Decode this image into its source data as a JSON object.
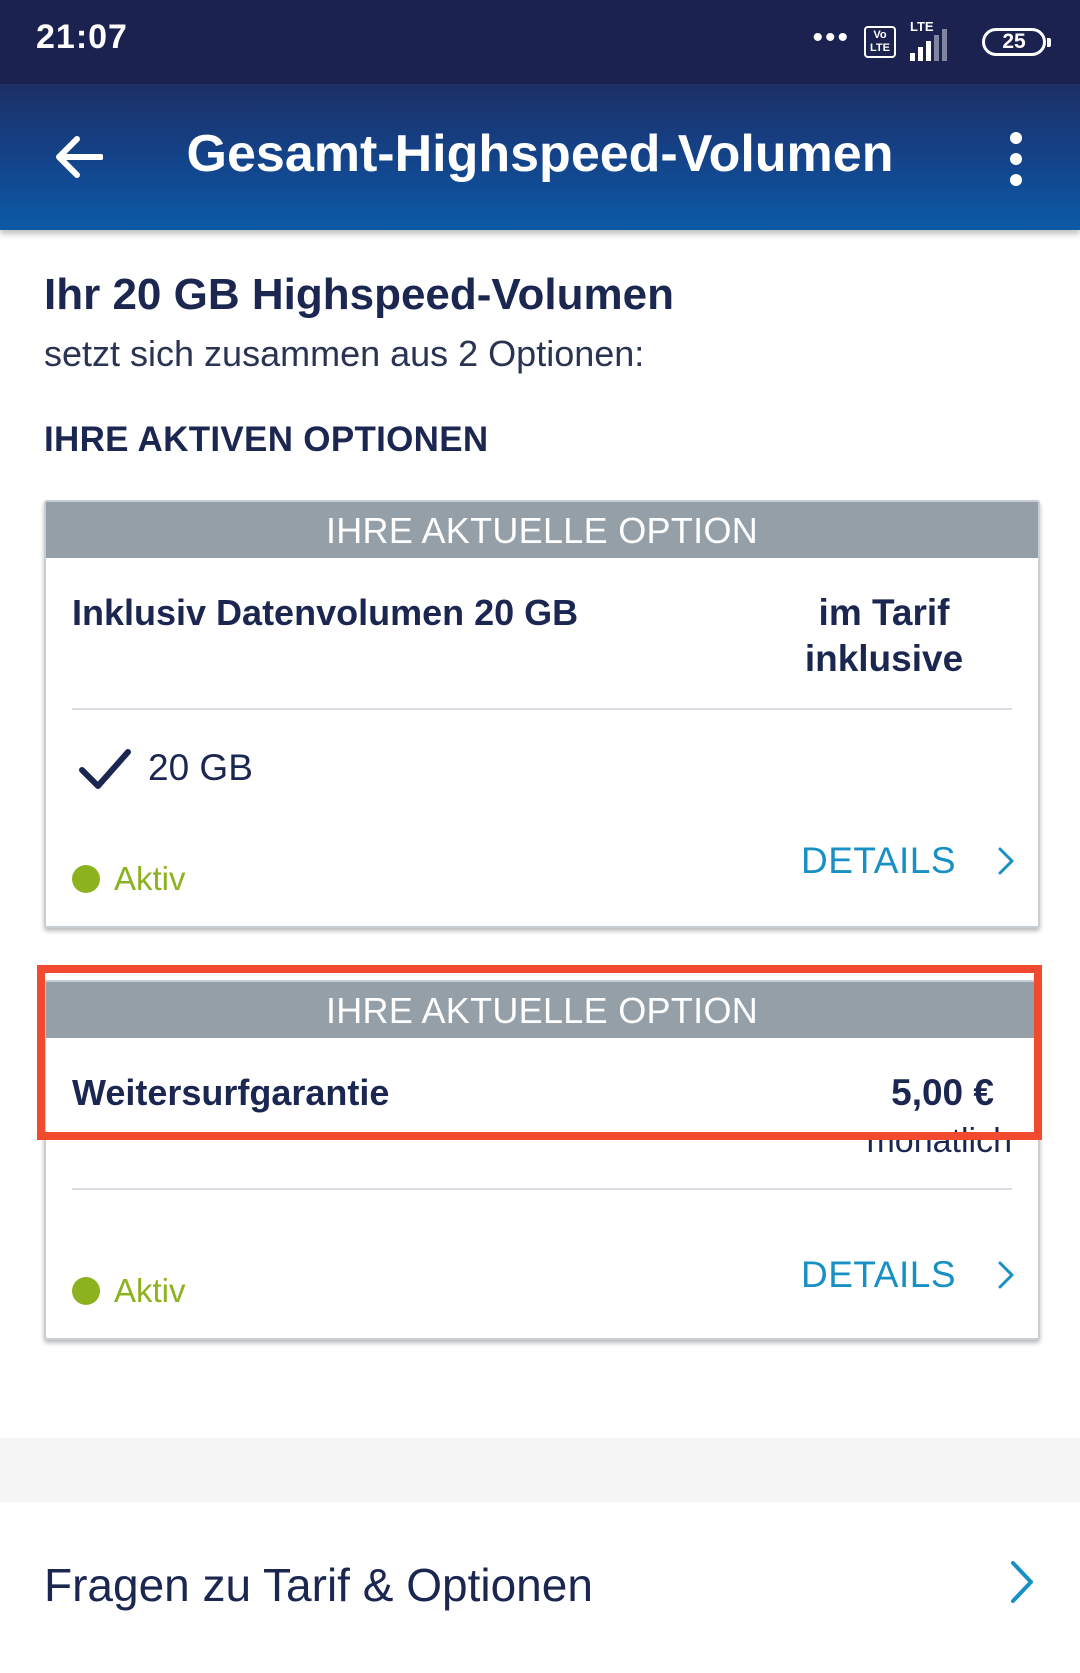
{
  "status_bar": {
    "time": "21:07",
    "volte": "Vo\nLTE",
    "network": "LTE",
    "battery": "25"
  },
  "app_bar": {
    "title": "Gesamt-Highspeed-Volumen",
    "back_icon": "arrow-left-icon",
    "menu_icon": "more-vert-icon"
  },
  "intro": {
    "heading": "Ihr 20 GB Highspeed-Volumen",
    "subheading": "setzt sich zusammen aus 2 Optionen:"
  },
  "section_label": "IHRE AKTIVEN OPTIONEN",
  "options": [
    {
      "header": "IHRE AKTUELLE OPTION",
      "name": "Inklusiv Datenvolumen 20 GB",
      "price_line1": "im Tarif",
      "price_line2": "inklusive",
      "feature": "20 GB",
      "status": "Aktiv",
      "details": "DETAILS"
    },
    {
      "header": "IHRE AKTUELLE OPTION",
      "name": "Weitersurfgarantie",
      "price": "5,00 €",
      "price_period": "monatlich",
      "status": "Aktiv",
      "details": "DETAILS"
    }
  ],
  "faq": {
    "label": "Fragen zu Tarif & Optionen"
  },
  "colors": {
    "appbar_dark": "#1c2f66",
    "appbar_light": "#0b5aa6",
    "card_header": "#949fa7",
    "active_green": "#8cb31f",
    "link_blue": "#1990c4",
    "highlight_red": "#f24a2f",
    "text_navy": "#1b2750"
  }
}
